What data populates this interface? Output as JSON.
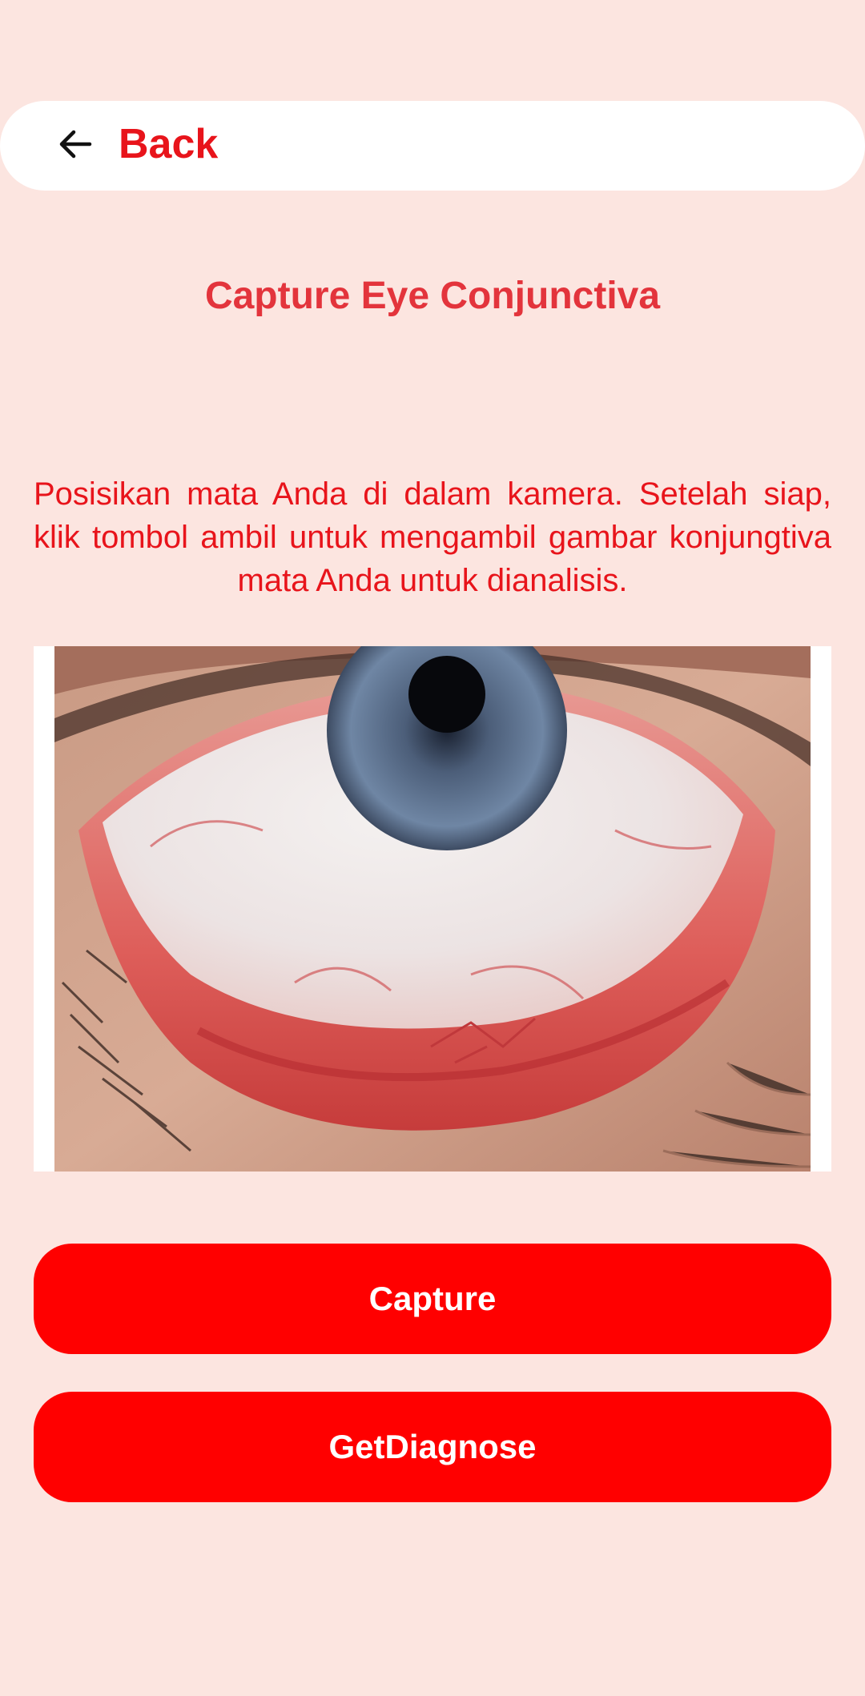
{
  "header": {
    "back_label": "Back",
    "back_icon": "arrow-left-icon"
  },
  "page": {
    "title": "Capture Eye Conjunctiva",
    "instruction": "Posisikan mata Anda di dalam kamera. Setelah siap, klik tombol ambil untuk mengambil gambar konjungtiva mata Anda untuk dianalisis."
  },
  "actions": {
    "capture_label": "Capture",
    "diagnose_label": "GetDiagnose"
  },
  "colors": {
    "background": "#fce5e0",
    "accent": "#ff0000",
    "title": "#e3343c",
    "text": "#e8141b"
  }
}
